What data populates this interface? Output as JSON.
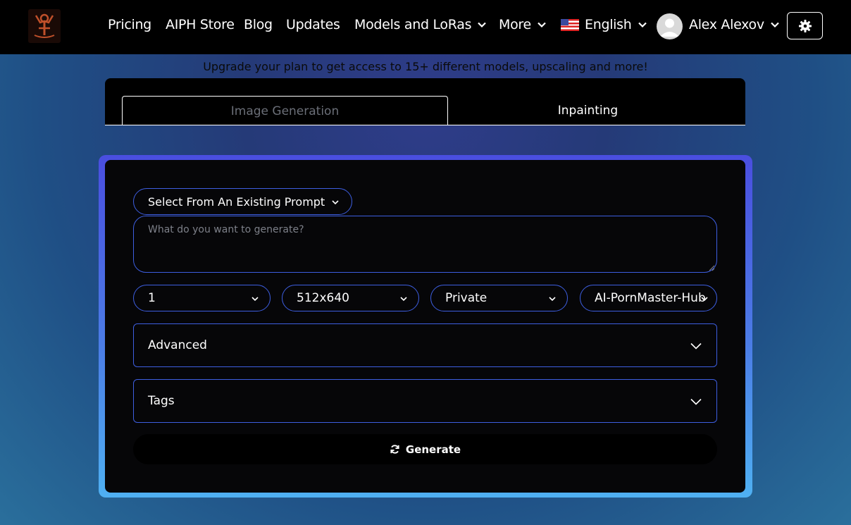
{
  "nav": {
    "links": [
      {
        "label": "Pricing"
      },
      {
        "label": "AIPH Store"
      },
      {
        "label": "Blog"
      },
      {
        "label": "Updates"
      },
      {
        "label": "Models and LoRas"
      },
      {
        "label": "More"
      }
    ],
    "language": "English",
    "user_name": "Alex Alexov"
  },
  "upgrade_banner": "Upgrade your plan to get access to 15+ different models, upscaling and more!",
  "tabs": [
    {
      "label": "Image Generation"
    },
    {
      "label": "Inpainting"
    }
  ],
  "form": {
    "prompt_select_label": "Select From An Existing Prompt",
    "prompt_placeholder": "What do you want to generate?",
    "selects": [
      {
        "value": "1"
      },
      {
        "value": "512x640"
      },
      {
        "value": "Private"
      },
      {
        "value": "AI-PornMaster-Hub"
      }
    ],
    "advanced_label": "Advanced",
    "tags_label": "Tags",
    "generate_label": "Generate"
  },
  "colors": {
    "accent_border": "#3d5ee0",
    "panel_bg": "#060608",
    "navbar_bg": "#000000"
  }
}
